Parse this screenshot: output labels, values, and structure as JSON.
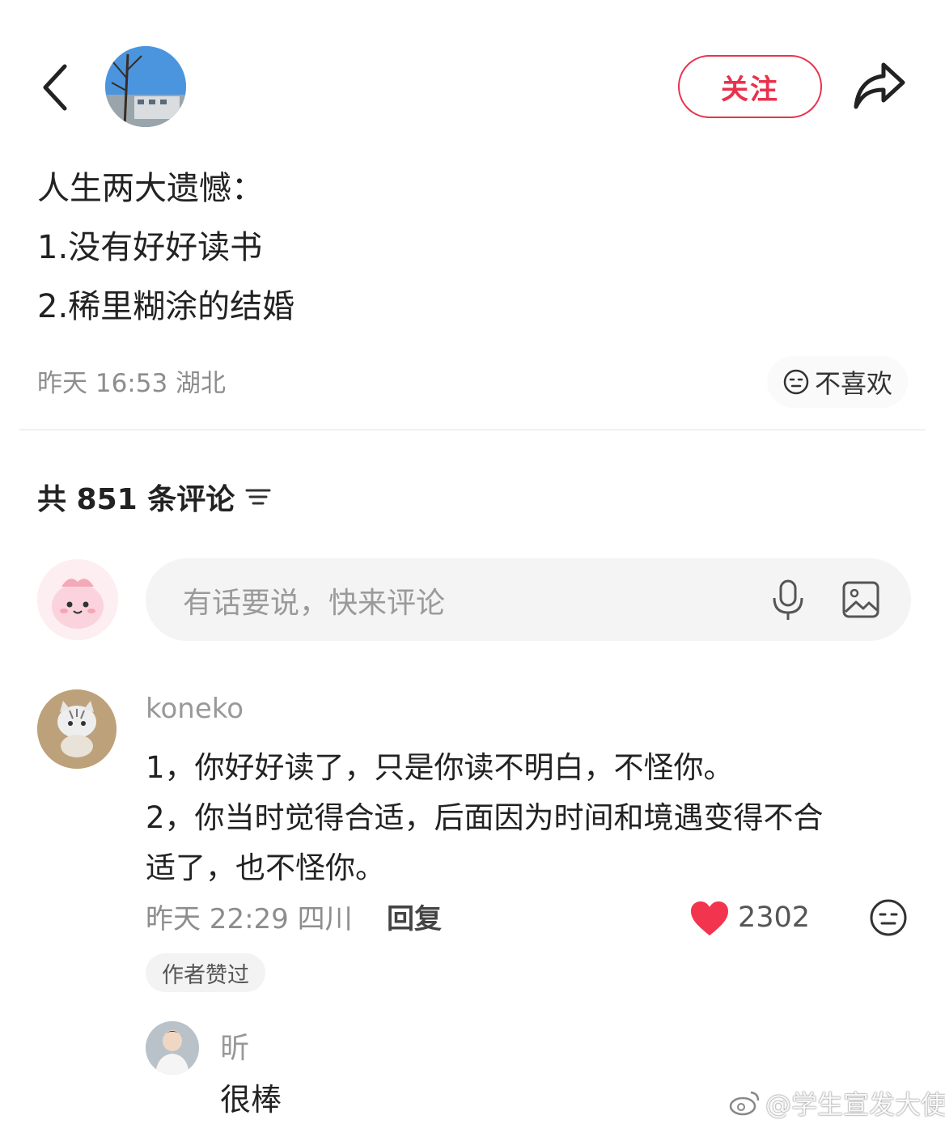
{
  "header": {
    "follow_label": "关注"
  },
  "post": {
    "lines": [
      "人生两大遗憾：",
      "1.没有好好读书",
      "2.稀里糊涂的结婚"
    ],
    "meta": "昨天 16:53 湖北",
    "dislike_label": "不喜欢"
  },
  "comments_header": {
    "count_label": "共 851 条评论"
  },
  "comment_input": {
    "placeholder": "有话要说，快来评论"
  },
  "comment": {
    "username": "koneko",
    "lines": [
      "1，你好好读了，只是你读不明白，不怪你。",
      "2，你当时觉得合适，后面因为时间和境遇变得不合",
      "适了，也不怪你。"
    ],
    "meta": "昨天 22:29 四川",
    "reply_label": "回复",
    "like_count": "2302",
    "author_liked_label": "作者赞过"
  },
  "reply": {
    "username": "昕",
    "text": "很棒"
  },
  "watermark": {
    "text": "@学生宣发大使"
  },
  "colors": {
    "accent": "#e8324c",
    "heart": "#f2344e",
    "muted_text": "#8d8d8d"
  },
  "icons": [
    "back-icon",
    "share-icon",
    "dislike-icon",
    "filter-icon",
    "mic-icon",
    "image-icon",
    "heart-icon",
    "weibo-icon"
  ]
}
